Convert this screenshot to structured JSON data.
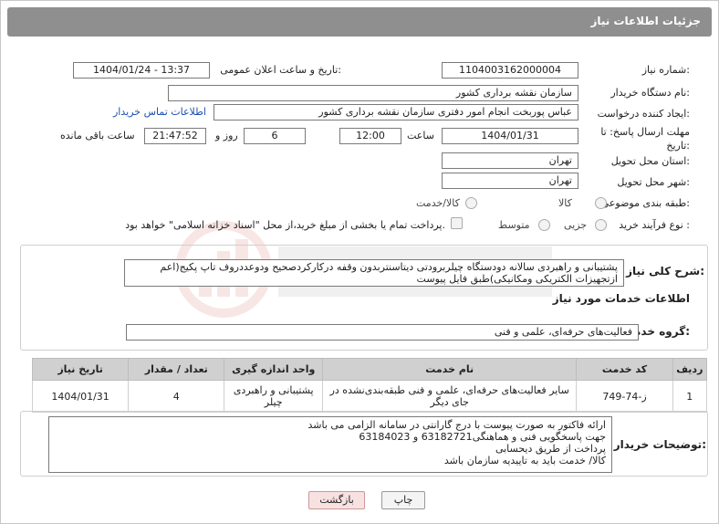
{
  "header": {
    "title": "جزئیات اطلاعات نیاز"
  },
  "form": {
    "need_number_label": "شماره نیاز:",
    "need_number": "1104003162000004",
    "announce_label": "تاریخ و ساعت اعلان عمومی:",
    "announce_value": "1404/01/24 - 13:37",
    "buyer_org_label": "نام دستگاه خریدار:",
    "buyer_org": "سازمان نقشه برداری کشور",
    "creator_label": "ایجاد کننده درخواست:",
    "creator": "عباس پوربخت انجام امور دفتری  سازمان نقشه برداری کشور",
    "contact_link": "اطلاعات تماس خریدار",
    "deadline_label": "مهلت ارسال پاسخ: تا تاریخ:",
    "deadline_date": "1404/01/31",
    "time_label": "ساعت",
    "deadline_time": "12:00",
    "days_value": "6",
    "days_label": "روز و",
    "remaining_time": "21:47:52",
    "remaining_label": "ساعت باقی مانده",
    "province_label": "استان محل تحویل:",
    "province": "تهران",
    "city_label": "شهر محل تحویل:",
    "city": "تهران",
    "category_label": "طبقه بندی موضوعی:",
    "category_options": [
      "کالا",
      "کالا/خدمت"
    ],
    "process_label": "نوع فرآیند خرید :",
    "process_options": [
      "جزیی",
      "متوسط"
    ],
    "payment_note": "پرداخت تمام یا بخشی از مبلغ خرید،از محل \"اسناد خزانه اسلامی\" خواهد بود."
  },
  "description": {
    "label": "شرح کلی نیاز:",
    "text": "پشتیبانی و راهبردی سالانه دودستگاه چیلربرودتی دیتاسنتربدون وقفه درکارکردصحیح ودوعددروف تاپ پکیج(اعم ازتجهیزات الکتریکی ومکانیکی)طبق فایل پیوست"
  },
  "services": {
    "section_title": "اطلاعات خدمات مورد نیاز",
    "group_label": "گروه خدمت:",
    "group_value": "فعالیت‌های حرفه‌ای، علمی و فنی",
    "columns": [
      "ردیف",
      "کد خدمت",
      "نام خدمت",
      "واحد اندازه گیری",
      "تعداد / مقدار",
      "تاریخ نیاز"
    ],
    "rows": [
      {
        "index": "1",
        "code": "ز-74-749",
        "name": "سایر فعالیت‌های حرفه‌ای، علمی و فنی طبقه‌بندی‌نشده در جای دیگر",
        "unit": "پشتیبانی و راهبردی چیلر",
        "quantity": "4",
        "date": "1404/01/31"
      }
    ]
  },
  "buyer_notes": {
    "label": "توضیحات خریدار:",
    "lines": [
      "ارائه فاکتور به صورت پیوست با درج گارانتی در سامانه الزامی می باشد",
      "جهت پاسخگویی فنی و هماهنگی63182721 و 63184023",
      "پرداخت از طریق دیحسابی",
      "کالا/ خدمت باید به تاییدیه سازمان باشد"
    ]
  },
  "buttons": {
    "print": "چاپ",
    "back": "بازگشت"
  },
  "colors": {
    "header_bg": "#8f8f8f",
    "link": "#1a4fb0",
    "back_button_bg": "#f8e1e1"
  }
}
